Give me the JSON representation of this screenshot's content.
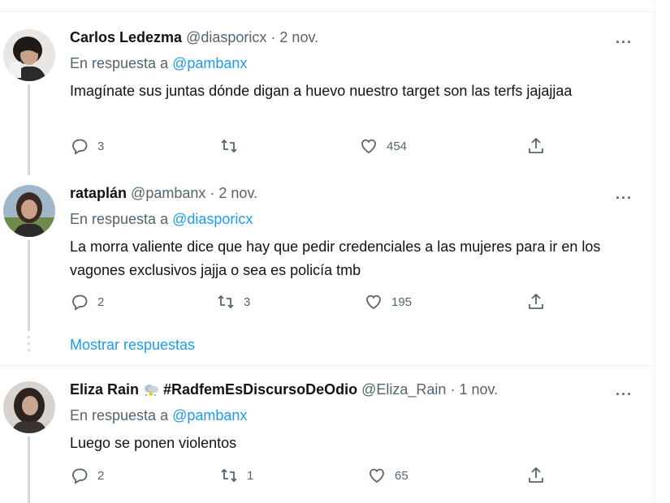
{
  "tweets": [
    {
      "name": "Carlos Ledezma",
      "handle": "@diasporicx",
      "date": "2 nov.",
      "reply_label": "En respuesta a",
      "reply_to": "@pambanx",
      "text": "Imagínate sus juntas dónde digan a huevo nuestro target son las terfs jajajjaa",
      "replies": "3",
      "retweets": "",
      "likes": "454"
    },
    {
      "name": "rataplán",
      "handle": "@pambanx",
      "date": "2 nov.",
      "reply_label": "En respuesta a",
      "reply_to": "@diasporicx",
      "text": "La morra valiente dice que hay que pedir credenciales a las mujeres para ir en los vagones exclusivos jajja o sea es policía tmb",
      "replies": "2",
      "retweets": "3",
      "likes": "195"
    },
    {
      "name": "Eliza Rain",
      "name_tag": "#RadfemEsDiscursoDeOdio",
      "handle": "@Eliza_Rain",
      "date": "1 nov.",
      "reply_label": "En respuesta a",
      "reply_to": "@pambanx",
      "text": "Luego se ponen violentos",
      "replies": "2",
      "retweets": "1",
      "likes": "65"
    }
  ],
  "separator_dot": "·",
  "more_label": "···",
  "show_replies": "Mostrar respuestas",
  "colors": {
    "accent": "#1d9bf0",
    "secondary_text": "#536471",
    "primary_text": "#0f1419",
    "thread_line": "#cfd9de"
  },
  "icons": {
    "reply": "reply-icon",
    "retweet": "retweet-icon",
    "like": "heart-icon",
    "share": "share-icon",
    "more": "more-icon",
    "emoji": "thunderstorm-emoji-icon"
  }
}
